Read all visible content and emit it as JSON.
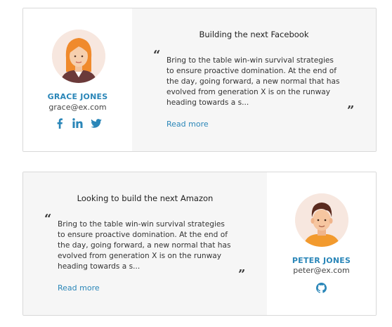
{
  "cards": [
    {
      "name": "GRACE JONES",
      "email": "grace@ex.com",
      "title": "Building the next Facebook",
      "body": "Bring to the table win-win survival strategies to ensure proactive domination. At the end of the day, going forward, a new normal that has evolved from generation X is on the runway heading towards a s...",
      "read_more": "Read more",
      "quote_open": "“",
      "quote_close": "”",
      "social": [
        "facebook-icon",
        "linkedin-icon",
        "twitter-icon"
      ],
      "social_text": {
        "facebook": "f",
        "linkedin": "in"
      }
    },
    {
      "name": "PETER JONES",
      "email": "peter@ex.com",
      "title": "Looking to build the next Amazon",
      "body": "Bring to the table win-win survival strategies to ensure proactive domination. At the end of the day, going forward, a new normal that has evolved from generation X is on the runway heading towards a s...",
      "read_more": "Read more",
      "quote_open": "“",
      "quote_close": "”",
      "social": [
        "github-icon"
      ]
    }
  ],
  "colors": {
    "accent": "#2a86b8",
    "panel_bg": "#f6f6f6",
    "border": "#d9d9d9"
  }
}
